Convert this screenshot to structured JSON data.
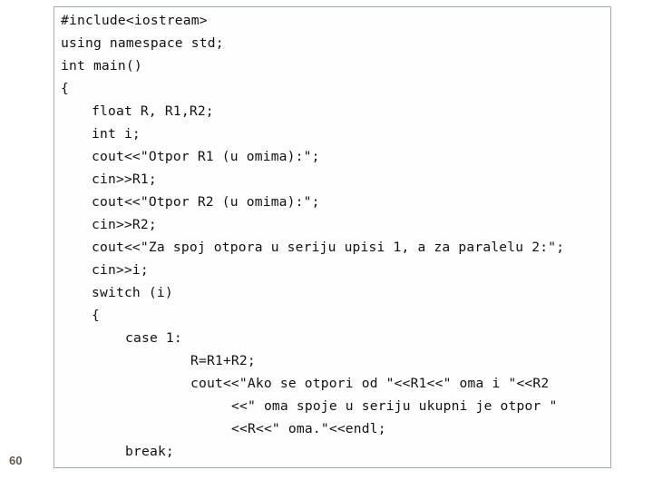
{
  "slide": {
    "page_number": "60",
    "code_lines": [
      {
        "indent": 0,
        "text": "#include<iostream>"
      },
      {
        "indent": 0,
        "text": "using namespace std;"
      },
      {
        "indent": 0,
        "text": "int main()"
      },
      {
        "indent": 0,
        "text": "{"
      },
      {
        "indent": 1,
        "text": "float R, R1,R2;"
      },
      {
        "indent": 1,
        "text": "int i;"
      },
      {
        "indent": 1,
        "text": "cout<<\"Otpor R1 (u omima):\";"
      },
      {
        "indent": 1,
        "text": "cin>>R1;"
      },
      {
        "indent": 1,
        "text": "cout<<\"Otpor R2 (u omima):\";"
      },
      {
        "indent": 1,
        "text": "cin>>R2;"
      },
      {
        "indent": 1,
        "text": "cout<<\"Za spoj otpora u seriju upisi 1, a za paralelu 2:\";"
      },
      {
        "indent": 1,
        "text": "cin>>i;"
      },
      {
        "indent": 1,
        "text": "switch (i)"
      },
      {
        "indent": 1,
        "text": "{"
      },
      {
        "indent": 2,
        "text": "case 1:"
      },
      {
        "indent": 3,
        "text": "R=R1+R2;"
      },
      {
        "indent": 3,
        "text": "cout<<\"Ako se otpori od \"<<R1<<\" oma i \"<<R2"
      },
      {
        "indent": 4,
        "text": "<<\" oma spoje u seriju ukupni je otpor \""
      },
      {
        "indent": 4,
        "text": "<<R<<\" oma.\"<<endl;"
      },
      {
        "indent": 2,
        "text": "break;"
      }
    ]
  }
}
